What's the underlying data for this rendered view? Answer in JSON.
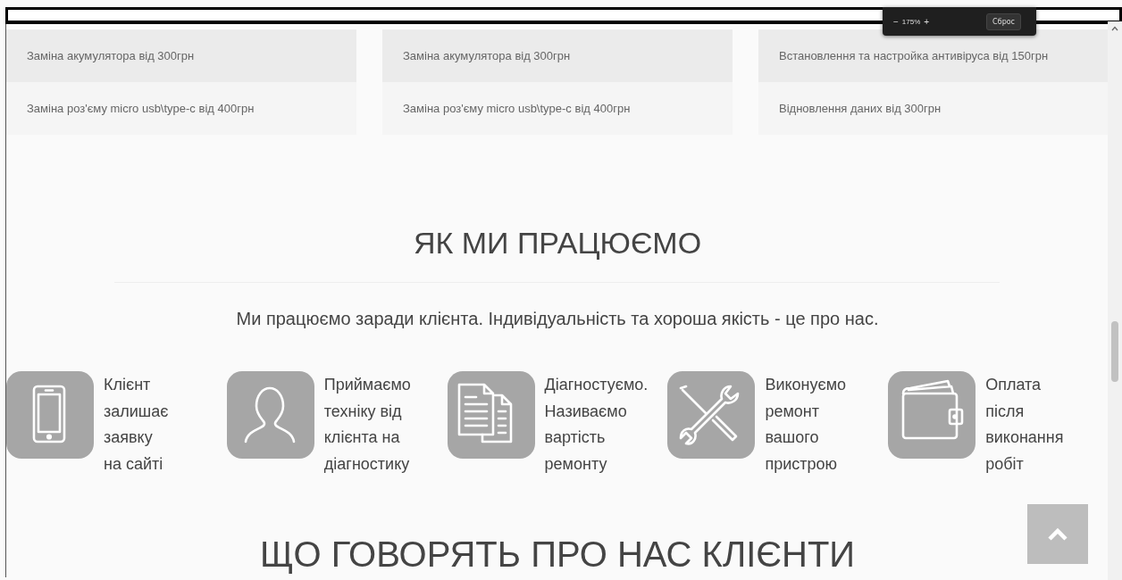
{
  "zoom_popup": {
    "decrease": "−",
    "level": "175%",
    "increase": "+",
    "reset": "Сброс"
  },
  "price_columns": [
    {
      "rows": [
        "Заміна акумулятора від 300грн",
        "Заміна роз'єму micro usb\\type-c від 400грн"
      ]
    },
    {
      "rows": [
        "Заміна акумулятора від 300грн",
        "Заміна роз'єму micro usb\\type-c від 400грн"
      ]
    },
    {
      "rows": [
        "Встановлення та настройка антивіруса від 150грн",
        "Відновлення даних від 300грн"
      ]
    }
  ],
  "how_we_work": {
    "title": "ЯК МИ ПРАЦЮЄМО",
    "subtitle": "Ми працюємо заради клієнта. Індивідуальність та хороша якість - це про нас.",
    "steps": [
      {
        "kind": "phone",
        "lines": [
          "Клієнт",
          "залишає",
          "заявку",
          "на сайті"
        ]
      },
      {
        "kind": "person",
        "lines": [
          "Приймаємо",
          "техніку від",
          "клієнта на",
          "діагностику"
        ]
      },
      {
        "kind": "documents",
        "lines": [
          "Діагностуємо.",
          "Називаємо",
          "вартість",
          "ремонту"
        ]
      },
      {
        "kind": "tools",
        "lines": [
          "Виконуємо",
          "ремонт",
          "вашого",
          "пристрою"
        ]
      },
      {
        "kind": "wallet",
        "lines": [
          "Оплата",
          "після",
          "виконання",
          "робіт"
        ]
      }
    ]
  },
  "reviews": {
    "title": "ЩО ГОВОРЯТЬ ПРО НАС КЛІЄНТИ"
  }
}
